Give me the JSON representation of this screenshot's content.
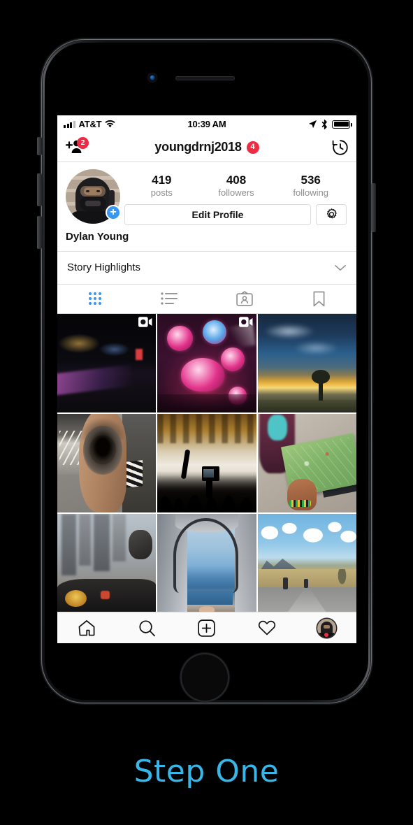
{
  "caption": {
    "text": "Step One",
    "color": "#38b6e8"
  },
  "device": {
    "front_camera_icon": "front-camera",
    "earpiece_icon": "earpiece-speaker",
    "home_button_icon": "home-button"
  },
  "statusbar": {
    "carrier": "AT&T",
    "signal_icon": "cellular-signal-icon",
    "wifi_icon": "wifi-icon",
    "time": "10:39 AM",
    "location_icon": "location-arrow-icon",
    "bluetooth_icon": "bluetooth-icon",
    "battery_icon": "battery-full-icon"
  },
  "navbar": {
    "add_person_icon": "add-person-icon",
    "add_person_badge": "2",
    "username": "youngdrnj2018",
    "username_badge": "4",
    "history_icon": "archive-clock-icon",
    "badge_color": "#ed2c43"
  },
  "profile": {
    "avatar_alt": "user-avatar-motorcycle-helmet",
    "add_story_label": "+",
    "add_story_color": "#3897f0",
    "full_name": "Dylan Young",
    "stats": [
      {
        "num": "419",
        "label": "posts"
      },
      {
        "num": "408",
        "label": "followers"
      },
      {
        "num": "536",
        "label": "following"
      }
    ],
    "edit_profile_label": "Edit Profile",
    "settings_icon": "gear-icon"
  },
  "story_highlights": {
    "label": "Story Highlights",
    "chevron_icon": "chevron-down-icon"
  },
  "tabs": [
    {
      "name": "grid",
      "icon": "grid-icon",
      "active": true,
      "active_color": "#3897f0"
    },
    {
      "name": "list",
      "icon": "list-icon",
      "active": false
    },
    {
      "name": "tagged",
      "icon": "tagged-photos-icon",
      "active": false
    },
    {
      "name": "saved",
      "icon": "bookmark-icon",
      "active": false
    }
  ],
  "grid": [
    {
      "id": "post-1",
      "art": "a-concert-dark",
      "is_video": true,
      "alt": "dark concert stage with purple lights"
    },
    {
      "id": "post-2",
      "art": "a-concert-pink",
      "is_video": true,
      "alt": "pink magenta concert video screens"
    },
    {
      "id": "post-3",
      "art": "a-storm",
      "is_video": false,
      "alt": "stormy blue sky over golden field with tree"
    },
    {
      "id": "post-4",
      "art": "a-tattoo",
      "is_video": false,
      "alt": "lion tattoo on upper arm"
    },
    {
      "id": "post-5",
      "art": "a-crowd",
      "is_video": false,
      "alt": "concert crowd silhouettes filming with phone"
    },
    {
      "id": "post-6",
      "art": "a-map",
      "is_video": false,
      "alt": "hands holding an open green map"
    },
    {
      "id": "post-7",
      "art": "a-city",
      "is_video": false,
      "alt": "city street viewed from a motorcycle"
    },
    {
      "id": "post-8",
      "art": "a-tent",
      "is_video": false,
      "alt": "ocean view from inside a tent"
    },
    {
      "id": "post-9",
      "art": "a-road",
      "is_video": false,
      "alt": "open road with motorcyclists and clouds"
    }
  ],
  "bottombar": {
    "items": [
      {
        "name": "home",
        "icon": "home-icon"
      },
      {
        "name": "search",
        "icon": "search-icon"
      },
      {
        "name": "add-post",
        "icon": "plus-square-icon"
      },
      {
        "name": "activity",
        "icon": "heart-icon"
      },
      {
        "name": "profile",
        "icon": "profile-avatar-icon",
        "has_dot": true,
        "dot_color": "#ed2c43"
      }
    ]
  }
}
